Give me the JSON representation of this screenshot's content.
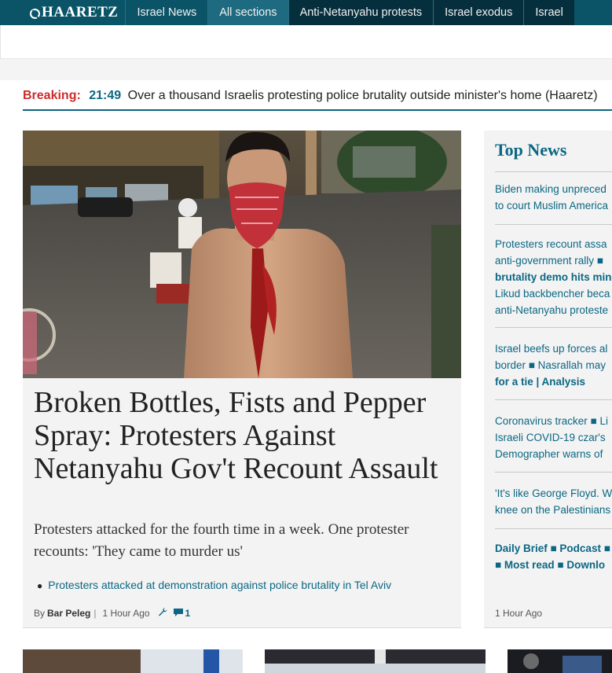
{
  "nav": {
    "logo": "HAARETZ",
    "items": [
      "Israel News",
      "All sections",
      "Anti-Netanyahu protests",
      "Israel exodus",
      "Israel"
    ]
  },
  "breaking": {
    "label": "Breaking:",
    "time": "21:49",
    "text": "Over a thousand Israelis protesting police brutality outside minister's home (Haaretz)"
  },
  "main_story": {
    "headline": "Broken Bottles, Fists and Pepper Spray: Protesters Against Netanyahu Gov't Recount Assault",
    "subhead": "Protesters attacked for the fourth time in a week. One protester recounts: 'They came to murder us'",
    "related_link": "Protesters attacked at demonstration against police brutality in Tel Aviv",
    "byline_prefix": "By",
    "author": "Bar Peleg",
    "byline_sep": "|",
    "time_ago": "1 Hour Ago",
    "comment_count": "1"
  },
  "top_news": {
    "title": "Top News",
    "items": [
      [
        "Biden making unpreced",
        "to court Muslim America"
      ],
      [
        "Protesters recount assa",
        "anti-government rally ■",
        "brutality demo hits minis",
        "Likud backbencher beca",
        "anti-Netanyahu proteste"
      ],
      [
        "Israel beefs up forces al",
        "border ■ Nasrallah may",
        "for a tie | Analysis"
      ],
      [
        "Coronavirus tracker ■ Li",
        "Israeli COVID-19 czar's",
        "Demographer warns of"
      ],
      [
        "'It's like George Floyd. W",
        "knee on the Palestinians"
      ],
      [
        "Daily Brief ■ Podcast ■",
        "■ Most read ■ Downlo"
      ]
    ],
    "time_ago": "1 Hour Ago"
  },
  "colors": {
    "nav_bg": "#0b5468",
    "accent": "#0b6783",
    "breaking_red": "#cc2b2b",
    "card_bg": "#f3f3f3"
  }
}
